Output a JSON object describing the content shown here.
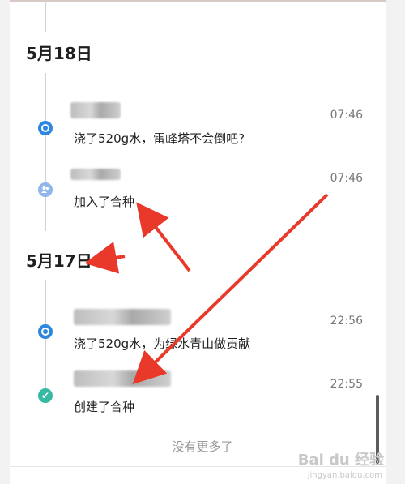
{
  "groups": [
    {
      "date": "5月18日",
      "events": [
        {
          "text": "浇了520g水，雷峰塔不会倒吧?",
          "time": "07:46",
          "icon": "water-drop-icon"
        },
        {
          "text": "加入了合种",
          "time": "07:46",
          "icon": "people-icon"
        }
      ]
    },
    {
      "date": "5月17日",
      "events": [
        {
          "text": "浇了520g水，为绿水青山做贡献",
          "time": "22:56",
          "icon": "water-drop-icon"
        },
        {
          "text": "创建了合种",
          "time": "22:55",
          "icon": "check-icon"
        }
      ]
    }
  ],
  "footer": {
    "no_more": "没有更多了"
  },
  "watermark": {
    "brand": "Bai du 经验",
    "url": "jingyan.baidu.com"
  },
  "colors": {
    "accent_blue": "#2e86de",
    "arrow_red": "#e8392b",
    "check_teal": "#36b9a3"
  }
}
